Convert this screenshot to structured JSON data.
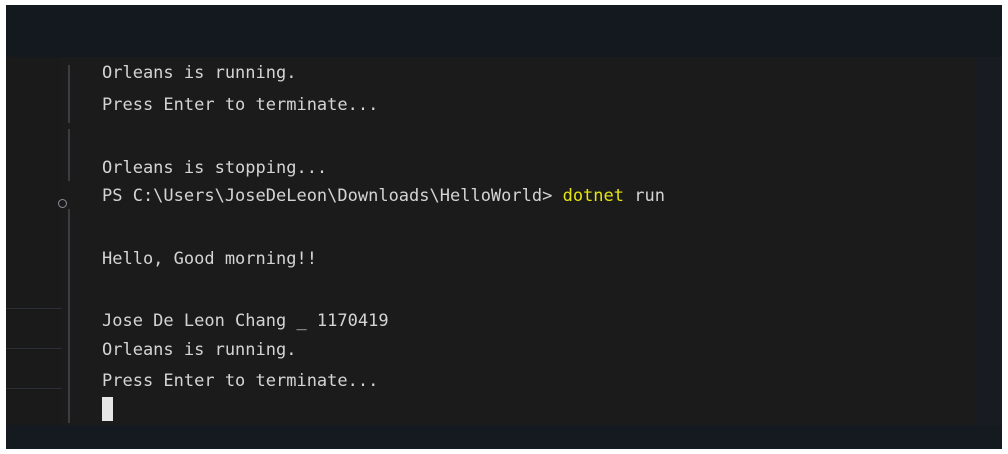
{
  "terminal": {
    "lines": [
      "Orleans is running.",
      "Press Enter to terminate...",
      "Orleans is stopping...",
      "Hello, Good morning!!",
      "Jose De Leon Chang _ 1170419",
      "Orleans is running.",
      "Press Enter to terminate..."
    ],
    "prompt": {
      "path": "PS C:\\Users\\JoseDeLeon\\Downloads\\HelloWorld> ",
      "command": "dotnet",
      "args": " run"
    }
  }
}
